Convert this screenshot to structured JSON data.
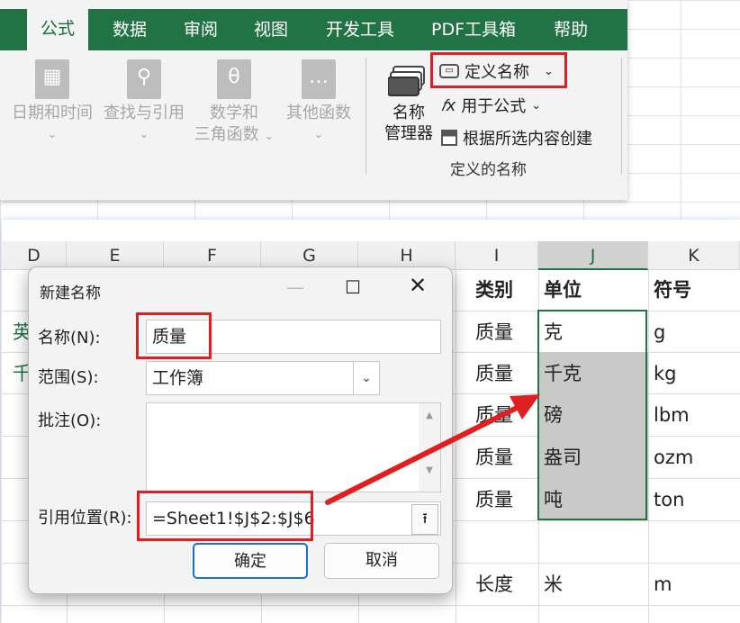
{
  "ribbon": {
    "tabs": [
      {
        "label": "公式",
        "active": true
      },
      {
        "label": "数据"
      },
      {
        "label": "审阅"
      },
      {
        "label": "视图"
      },
      {
        "label": "开发工具"
      },
      {
        "label": "PDF工具箱"
      },
      {
        "label": "帮助"
      }
    ],
    "function_groups": [
      {
        "line1": "日期和时间",
        "line2": "",
        "icon": "calendar-book-icon"
      },
      {
        "line1": "查找与引用",
        "line2": "",
        "icon": "magnifier-book-icon"
      },
      {
        "line1": "数学和",
        "line2": "三角函数",
        "icon": "theta-book-icon"
      },
      {
        "line1": "其他函数",
        "line2": "",
        "icon": "dots-book-icon"
      }
    ],
    "name_manager": {
      "line1": "名称",
      "line2": "管理器"
    },
    "define_name": "定义名称",
    "use_in_formula": "用于公式",
    "create_from_selection": "根据所选内容创建",
    "group_label": "定义的名称"
  },
  "sheet": {
    "columns": [
      "D",
      "E",
      "F",
      "G",
      "H",
      "I",
      "J",
      "K"
    ],
    "selected_column": "J",
    "header_row": {
      "I": "类别",
      "J": "单位",
      "K": "符号"
    },
    "rows": [
      {
        "I": "质量",
        "J": "克",
        "K": "g"
      },
      {
        "I": "质量",
        "J": "千克",
        "K": "kg"
      },
      {
        "I": "质量",
        "J": "磅",
        "K": "lbm"
      },
      {
        "I": "质量",
        "J": "盎司",
        "K": "ozm"
      },
      {
        "I": "质量",
        "J": "吨",
        "K": "ton"
      },
      {
        "I": "",
        "J": "",
        "K": ""
      },
      {
        "I": "长度",
        "J": "米",
        "K": "m"
      }
    ],
    "partial_left": [
      "英",
      "千"
    ]
  },
  "dialog": {
    "title": "新建名称",
    "name_label": "名称(N):",
    "name_value": "质量",
    "scope_label": "范围(S):",
    "scope_value": "工作簿",
    "comment_label": "批注(O):",
    "refers_label": "引用位置(R):",
    "refers_value": "=Sheet1!$J$2:$J$6",
    "ok": "确定",
    "cancel": "取消"
  },
  "colors": {
    "excel_green": "#217346",
    "highlight_red": "#e02020",
    "selected_grey": "#c9c9c9"
  }
}
